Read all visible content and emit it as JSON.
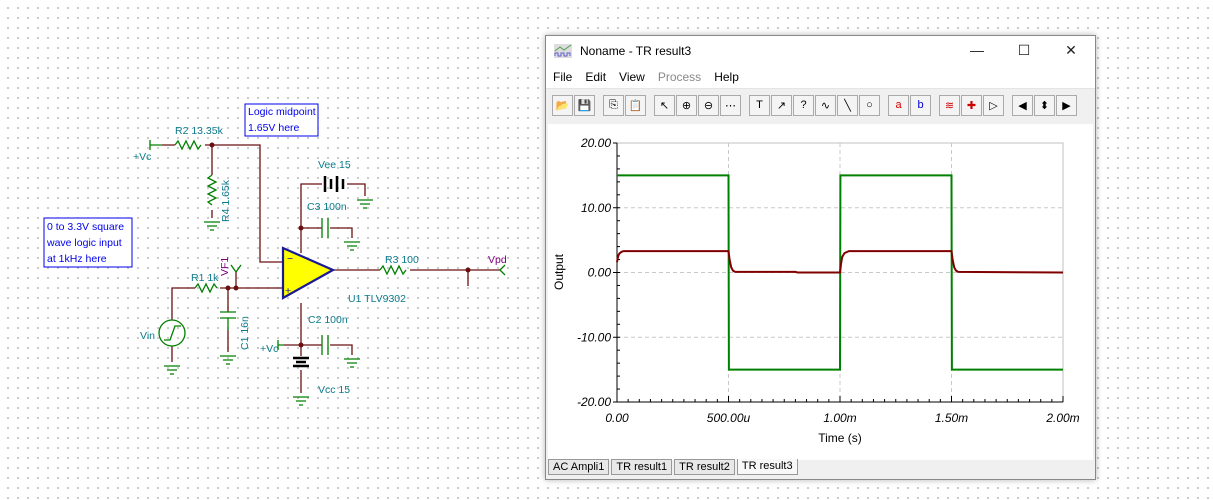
{
  "schematic": {
    "note_midpoint": [
      "Logic midpoint",
      "1.65V here"
    ],
    "note_input": [
      "0 to 3.3V square",
      "wave logic input",
      "at 1kHz here"
    ],
    "r2": "R2 13.35k",
    "r4": "R4 1.65k",
    "r1": "R1 1k",
    "c1": "C1 16n",
    "vf1": "VF1",
    "vin": "Vin",
    "vc_top": "+Vc",
    "vc_bottom": "+Vc",
    "vee": "Vee 15",
    "vcc": "Vcc 15",
    "c3": "C3 100n",
    "c2": "C2 100n",
    "r3": "R3 100",
    "vpd": "Vpd",
    "u1": "U1 TLV9302",
    "opamp_minus": "−",
    "opamp_plus": "+"
  },
  "window": {
    "title": "Noname - TR result3",
    "controls": {
      "minimize": "—",
      "maximize": "☐",
      "close": "✕"
    },
    "menu": [
      {
        "label": "File"
      },
      {
        "label": "Edit"
      },
      {
        "label": "View"
      },
      {
        "label": "Process",
        "disabled": true
      },
      {
        "label": "Help"
      }
    ],
    "toolbar": [
      {
        "icon": "open-icon",
        "glyph": "📂"
      },
      {
        "icon": "save-icon",
        "glyph": "💾"
      },
      {
        "icon": "copy-icon",
        "glyph": "⎘"
      },
      {
        "icon": "paste-icon",
        "glyph": "📋"
      },
      {
        "icon": "pointer-icon",
        "glyph": "↖"
      },
      {
        "icon": "zoom-in-icon",
        "glyph": "⊕"
      },
      {
        "icon": "zoom-out-icon",
        "glyph": "⊖"
      },
      {
        "icon": "grid-icon",
        "glyph": "⋯"
      },
      {
        "icon": "text-icon",
        "glyph": "T"
      },
      {
        "icon": "curve-label-icon",
        "glyph": "↗"
      },
      {
        "icon": "curve-question-icon",
        "glyph": "?"
      },
      {
        "icon": "curve-formula-icon",
        "glyph": "∿"
      },
      {
        "icon": "line-icon",
        "glyph": "╲"
      },
      {
        "icon": "circle-icon",
        "glyph": "○"
      },
      {
        "icon": "cursor-a-icon",
        "glyph": "a"
      },
      {
        "icon": "cursor-b-icon",
        "glyph": "b"
      },
      {
        "icon": "add-curve-icon",
        "glyph": "≋"
      },
      {
        "icon": "add-probe-icon",
        "glyph": "✚"
      },
      {
        "icon": "arrow-icon",
        "glyph": "▷"
      },
      {
        "icon": "left-icon",
        "glyph": "◀"
      },
      {
        "icon": "up-down-icon",
        "glyph": "⬍"
      },
      {
        "icon": "right-icon",
        "glyph": "▶"
      }
    ],
    "tabs": [
      {
        "label": "AC Ampli1"
      },
      {
        "label": "TR result1"
      },
      {
        "label": "TR result2"
      },
      {
        "label": "TR result3",
        "active": true
      }
    ]
  },
  "chart_data": {
    "type": "line",
    "xlabel": "Time (s)",
    "ylabel": "Output",
    "xlim": [
      0,
      0.002
    ],
    "ylim": [
      -20,
      20
    ],
    "xticks": [
      {
        "value": 0,
        "label": "0.00"
      },
      {
        "value": 0.0005,
        "label": "500.00u"
      },
      {
        "value": 0.001,
        "label": "1.00m"
      },
      {
        "value": 0.0015,
        "label": "1.50m"
      },
      {
        "value": 0.002,
        "label": "2.00m"
      }
    ],
    "yticks": [
      {
        "value": 20,
        "label": "20.00"
      },
      {
        "value": 10,
        "label": "10.00"
      },
      {
        "value": 0,
        "label": "0.00"
      },
      {
        "value": -10,
        "label": "-10.00"
      },
      {
        "value": -20,
        "label": "-20.00"
      }
    ],
    "grid": true,
    "series": [
      {
        "color": "#008000",
        "points": [
          [
            0,
            15
          ],
          [
            0.0005,
            15
          ],
          [
            0.000502,
            -15
          ],
          [
            0.001,
            -15
          ],
          [
            0.001002,
            15
          ],
          [
            0.0015,
            15
          ],
          [
            0.001502,
            -15
          ],
          [
            0.002,
            -15
          ]
        ]
      },
      {
        "color": "#800000",
        "points": [
          [
            0,
            1.6
          ],
          [
            5e-06,
            2.5
          ],
          [
            1e-05,
            2.9
          ],
          [
            2e-05,
            3.2
          ],
          [
            3e-05,
            3.3
          ],
          [
            0.0005,
            3.3
          ],
          [
            0.000505,
            2.0
          ],
          [
            0.000512,
            0.8
          ],
          [
            0.00052,
            0.3
          ],
          [
            0.00053,
            0.1
          ],
          [
            0.0008,
            0.1
          ],
          [
            0.00081,
            0
          ],
          [
            0.001,
            0
          ],
          [
            0.001005,
            1.4
          ],
          [
            0.00101,
            2.4
          ],
          [
            0.00102,
            3.0
          ],
          [
            0.00104,
            3.3
          ],
          [
            0.0015,
            3.3
          ],
          [
            0.001505,
            2.0
          ],
          [
            0.001512,
            0.8
          ],
          [
            0.00152,
            0.3
          ],
          [
            0.00153,
            0.1
          ],
          [
            0.002,
            0
          ]
        ]
      }
    ]
  }
}
